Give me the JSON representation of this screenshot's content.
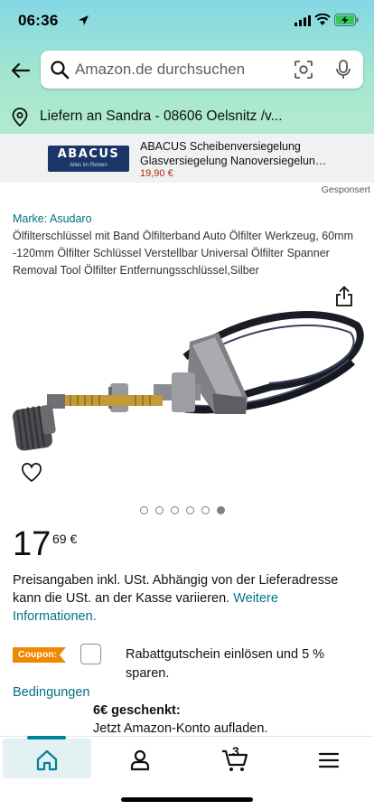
{
  "status_bar": {
    "time": "06:36"
  },
  "search": {
    "placeholder": "Amazon.de durchsuchen"
  },
  "delivery": {
    "text": "Liefern an Sandra - 08606 Oelsnitz /v..."
  },
  "sponsored_ad": {
    "logo_text": "ABACUS",
    "logo_tagline": "Alles im Reinen",
    "title": "ABACUS Scheibenversiegelung Glasversiegelung Nanoversiegelun…",
    "price": "19,90 €",
    "sponsored_label": "Gesponsert"
  },
  "product": {
    "brand": "Marke: Asudaro",
    "title": "Ölfilterschlüssel mit Band Ölfilterband Auto Ölfilter Werkzeug, 60mm -120mm Ölfilter Schlüssel Verstellbar Universal Ölfilter Spanner Removal Tool Ölfilter Entfernungsschlüssel,Silber",
    "image_count": 6,
    "active_image_index": 5,
    "price_whole": "17",
    "price_fraction": "69 €",
    "vat_text": "Preisangaben inkl. USt. Abhängig von der Lieferadresse kann die USt. an der Kasse variieren.",
    "vat_link": "Weitere Informationen."
  },
  "coupon": {
    "badge": "Coupon:",
    "text": "Rabattgutschein einlösen und 5 % sparen.",
    "link": "Bedingungen"
  },
  "gift": {
    "headline": "6€ geschenkt:",
    "text": "Jetzt Amazon-Konto aufladen."
  },
  "bottom_nav": {
    "items": [
      "home-icon",
      "account-icon",
      "cart-icon",
      "menu-icon"
    ],
    "cart_count": "3",
    "active": "home-icon"
  },
  "colors": {
    "link": "#007185",
    "accent_teal": "#008296",
    "coupon_orange": "#f08804",
    "price_red": "#b12704",
    "header_gradient": [
      "#84d8e3",
      "#b2ead0"
    ]
  }
}
